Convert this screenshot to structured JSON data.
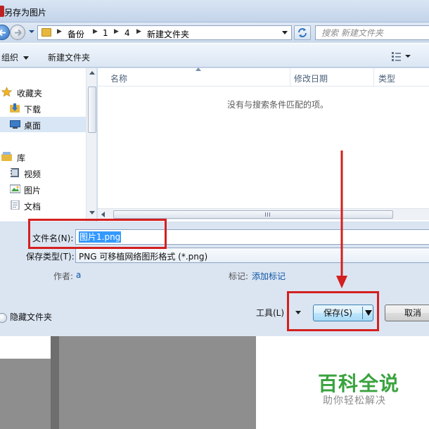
{
  "window": {
    "title": "另存为图片"
  },
  "address": {
    "crumbs": [
      "备份",
      "1",
      "4",
      "新建文件夹"
    ],
    "search_placeholder": "搜索 新建文件夹"
  },
  "toolbar": {
    "organize_label": "组织",
    "new_folder_label": "新建文件夹"
  },
  "nav_pane": {
    "favorites_label": "收藏夹",
    "downloads_label": "下载",
    "desktop_label": "桌面",
    "library_label": "库",
    "videos_label": "视频",
    "pictures_label": "图片",
    "documents_label": "文档"
  },
  "file_list": {
    "columns": [
      "名称",
      "修改日期",
      "类型"
    ],
    "empty_message": "没有与搜索条件匹配的项。"
  },
  "form": {
    "filename_label": "文件名(N):",
    "filename_value": "图片1.png",
    "filetype_label": "保存类型(T):",
    "filetype_value": "PNG 可移植网络图形格式 (*.png)",
    "author_label": "作者:",
    "author_value": "a",
    "tags_label": "标记:",
    "tags_link": "添加标记"
  },
  "footer": {
    "hide_folders_label": "隐藏文件夹",
    "tools_label": "工具(L)",
    "save_label": "保存(S)",
    "cancel_label": "取消"
  },
  "watermark": {
    "main": "百科全说",
    "sub": "助你轻松解决"
  },
  "colors": {
    "highlight": "#d3201f",
    "selection": "#3399ff",
    "watermark": "#3aa33f"
  }
}
